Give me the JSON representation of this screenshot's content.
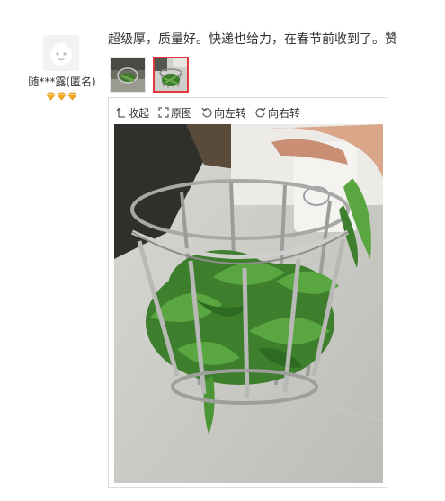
{
  "reviewer": {
    "name": "随***露(匿名)",
    "avatar_icon": "avatar-face-icon",
    "level_icon": "diamond-icon",
    "level_count": 3
  },
  "review": {
    "text": "超级厚，质量好。快递也给力，在春节前收到了。赞"
  },
  "thumbnails": [
    {
      "name": "review-photo-thumb-1",
      "selected": false
    },
    {
      "name": "review-photo-thumb-2",
      "selected": true
    }
  ],
  "viewer": {
    "collapse_label": "收起",
    "original_label": "原图",
    "rotate_left_label": "向左转",
    "rotate_right_label": "向右转"
  },
  "colors": {
    "accent_border": "#e4393c",
    "left_rule": "#4aa36e",
    "gem": "#f5a623"
  }
}
